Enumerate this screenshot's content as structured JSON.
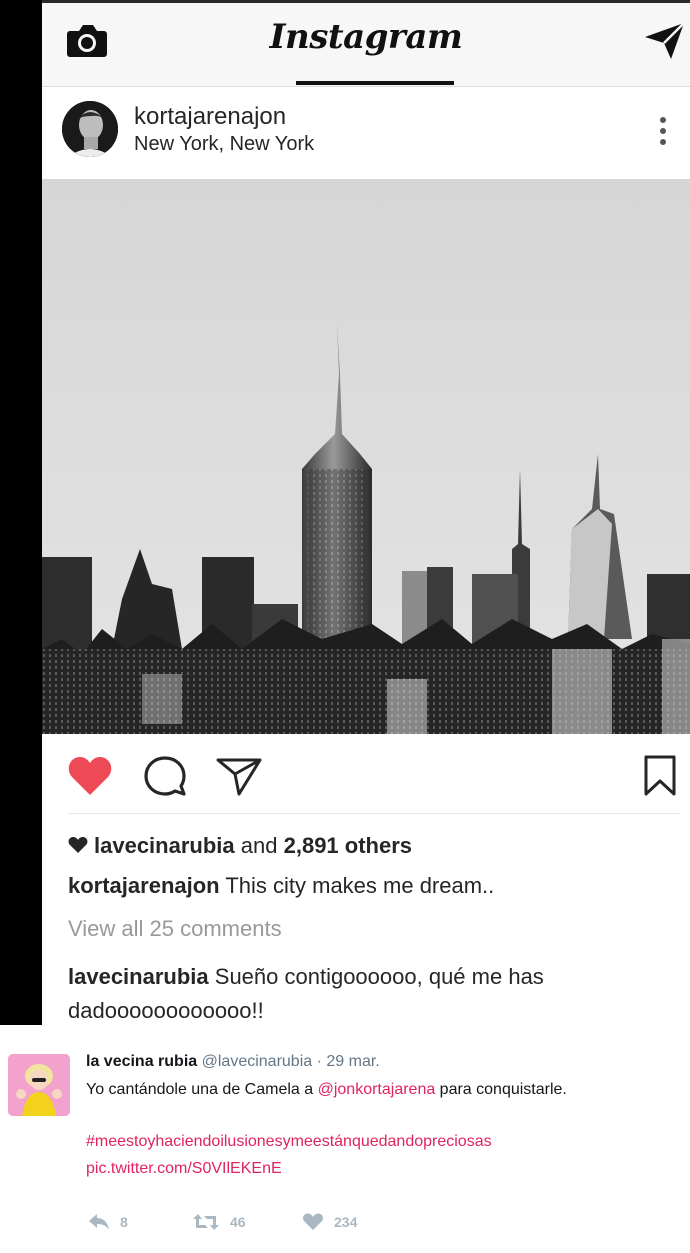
{
  "instagram": {
    "brand": "Instagram",
    "post": {
      "username": "kortajarenajon",
      "location": "New York, New York",
      "likes": {
        "liker": "lavecinarubia",
        "and": "and",
        "others": "2,891 others"
      },
      "caption": {
        "user": "kortajarenajon",
        "text": "This city makes me dream.."
      },
      "view_comments": "View all 25 comments",
      "comment": {
        "user": "lavecinarubia",
        "text": "Sueño contigoooooo, qué me has dadoooooooooooo!!"
      },
      "liked": true
    },
    "icons": {
      "camera": "camera-icon",
      "direct": "direct-message-icon",
      "more": "more-options-icon",
      "like": "heart-icon",
      "comment": "comment-icon",
      "share": "share-icon",
      "save": "bookmark-icon"
    },
    "colors": {
      "like": "#ed4956"
    }
  },
  "tweet": {
    "name": "la vecina rubia",
    "handle": "@lavecinarubia",
    "separator": "·",
    "date": "29 mar.",
    "text_before": "Yo cantándole una de Camela a ",
    "mention": "@jonkortajarena",
    "text_after": " para conquistarle.",
    "hashtag": "#meestoyhaciendoilusionesymeestánquedandopreciosas",
    "pic_link": "pic.twitter.com/S0VIlEKEnE",
    "replies": "8",
    "retweets": "46",
    "likes": "234",
    "colors": {
      "link": "#e0245e",
      "muted": "#aab8c2"
    }
  }
}
